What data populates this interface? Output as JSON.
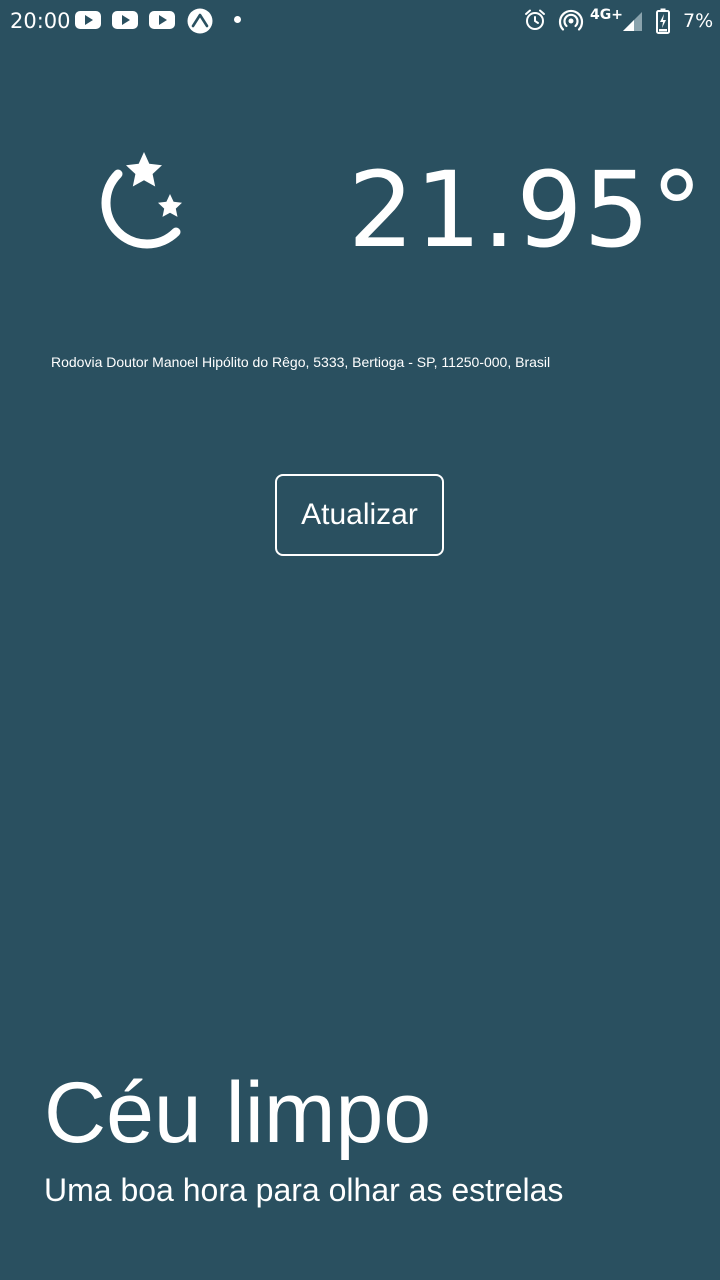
{
  "status_bar": {
    "time": "20:00",
    "network": "4G+",
    "battery_percent": "7%",
    "notification_icons": [
      "youtube-icon",
      "youtube-icon",
      "youtube-icon",
      "expo-icon"
    ],
    "system_icons": [
      "alarm-icon",
      "hotspot-icon",
      "signal-icon",
      "battery-charging-icon"
    ]
  },
  "weather": {
    "icon": "moon-stars-icon",
    "temperature": "21.95°",
    "address": "Rodovia Doutor Manoel Hipólito do Rêgo, 5333, Bertioga - SP, 11250-000, Brasil",
    "refresh_label": "Atualizar",
    "condition": "Céu limpo",
    "message": "Uma boa hora para olhar as estrelas"
  },
  "colors": {
    "background": "#2a5060",
    "foreground": "#ffffff"
  }
}
